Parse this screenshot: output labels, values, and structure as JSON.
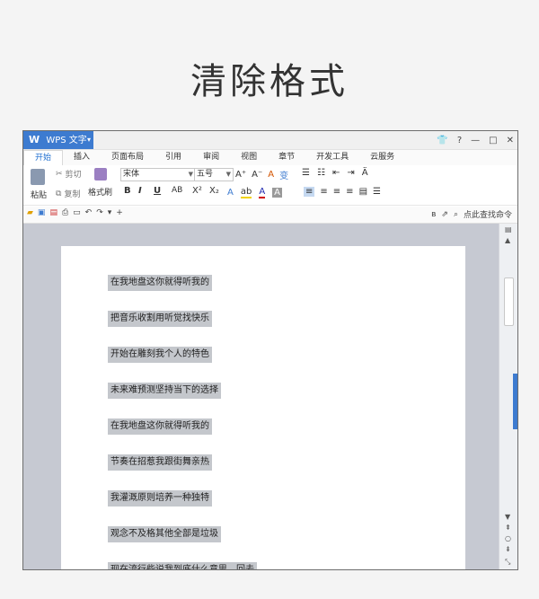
{
  "page_title": "清除格式",
  "app": {
    "logo": "W",
    "name": "WPS 文字"
  },
  "window_controls": {
    "skin": "👕",
    "help": "?",
    "min": "—",
    "max": "□",
    "close": "✕"
  },
  "tabs": [
    "开始",
    "插入",
    "页面布局",
    "引用",
    "审阅",
    "视图",
    "章节",
    "开发工具",
    "云服务"
  ],
  "ribbon": {
    "paste": "粘贴",
    "cut": "剪切",
    "copy": "复制",
    "format_painter": "格式刷",
    "font": "宋体",
    "size": "五号",
    "bold": "B",
    "italic": "I",
    "underline": "U",
    "abc": "AB",
    "sup": "X²",
    "sub": "X₂"
  },
  "qat": {
    "find": "点此查找命令"
  },
  "document": {
    "lines": [
      "在我地盘这你就得听我的",
      "把音乐收割用听觉找快乐",
      "开始在雕刻我个人的特色",
      "未来难预测坚持当下的选择",
      "在我地盘这你就得听我的",
      "节奏在招惹我跟街舞亲热",
      "我灌溉原则培养一种独特",
      "观念不及格其他全部是垃圾",
      "现在流行些说我到底什么意思，回去"
    ]
  }
}
